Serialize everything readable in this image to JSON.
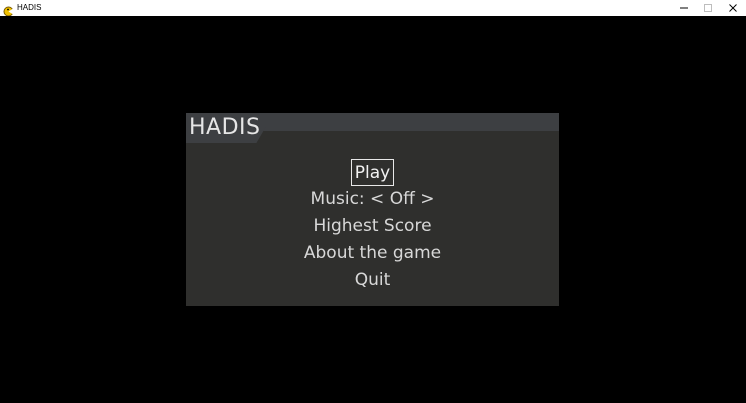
{
  "window": {
    "title": "HADIS",
    "controls": {
      "minimize": "─",
      "maximize": "☐",
      "close": "✕"
    }
  },
  "menu": {
    "title": "HADIS",
    "items": [
      {
        "label": "Play",
        "selected": true
      },
      {
        "label": "Music: < Off >",
        "selected": false
      },
      {
        "label": "Highest Score",
        "selected": false
      },
      {
        "label": "About the game",
        "selected": false
      },
      {
        "label": "Quit",
        "selected": false
      }
    ]
  },
  "colors": {
    "background": "#000000",
    "panel": "#2f2f2d",
    "panel_header": "#3d3f42",
    "text": "#d8d8d8",
    "selection_border": "#e8e8e8"
  }
}
